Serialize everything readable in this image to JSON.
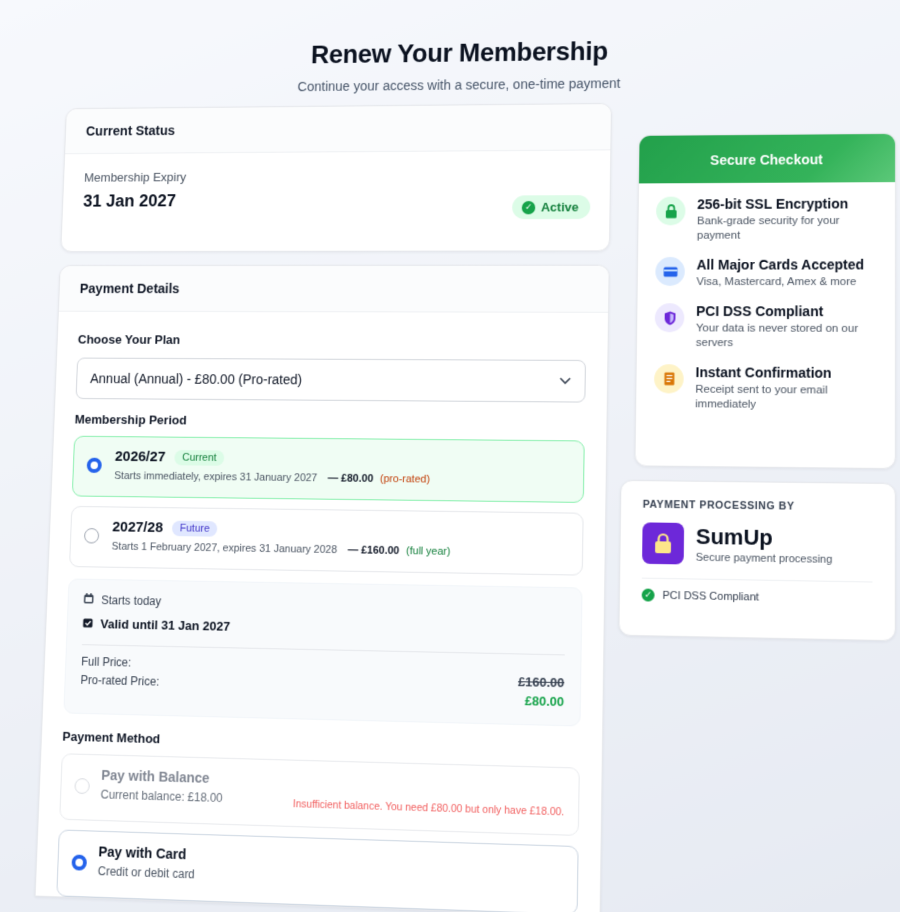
{
  "header": {
    "title": "Renew Your Membership",
    "subtitle": "Continue your access with a secure, one-time payment"
  },
  "status": {
    "heading": "Current Status",
    "expiry_label": "Membership Expiry",
    "expiry_date": "31 Jan 2027",
    "badge": "Active"
  },
  "payment": {
    "heading": "Payment Details",
    "plan_label": "Choose Your Plan",
    "plan_value": "Annual (Annual) - £80.00 (Pro-rated)",
    "period_label": "Membership Period",
    "periods": [
      {
        "title": "2026/27",
        "tag": "Current",
        "desc": "Starts immediately, expires 31 January 2027",
        "price": "— £80.00",
        "note": "(pro-rated)",
        "selected": true
      },
      {
        "title": "2027/28",
        "tag": "Future",
        "desc": "Starts 1 February 2027, expires 31 January 2028",
        "price": "— £160.00",
        "note": "(full year)",
        "selected": false
      }
    ],
    "summary": {
      "starts": "Starts today",
      "valid": "Valid until 31 Jan 2027",
      "full_price_label": "Full Price:",
      "prorated_label": "Pro-rated Price:",
      "full_price": "£160.00",
      "prorated_price": "£80.00"
    },
    "method_label": "Payment Method",
    "methods": [
      {
        "title": "Pay with Balance",
        "sub": "Current balance: £18.00",
        "error": "Insufficient balance. You need £80.00 but only have £18.00.",
        "disabled": true
      },
      {
        "title": "Pay with Card",
        "sub": "Credit or debit card",
        "selected": true
      }
    ]
  },
  "secure": {
    "heading": "Secure Checkout",
    "features": [
      {
        "icon": "lock-icon",
        "title": "256-bit SSL Encryption",
        "sub": "Bank-grade security for your payment"
      },
      {
        "icon": "card-icon",
        "title": "All Major Cards Accepted",
        "sub": "Visa, Mastercard, Amex & more"
      },
      {
        "icon": "shield-icon",
        "title": "PCI DSS Compliant",
        "sub": "Your data is never stored on our servers"
      },
      {
        "icon": "receipt-icon",
        "title": "Instant Confirmation",
        "sub": "Receipt sent to your email immediately"
      }
    ]
  },
  "processor": {
    "label": "PAYMENT PROCESSING BY",
    "name": "SumUp",
    "sub": "Secure payment processing",
    "pci": "PCI DSS Compliant"
  },
  "colors": {
    "accent_green": "#22a04b",
    "accent_blue": "#2563eb",
    "error_red": "#ef4444",
    "sumup_purple": "#6d28d9"
  }
}
